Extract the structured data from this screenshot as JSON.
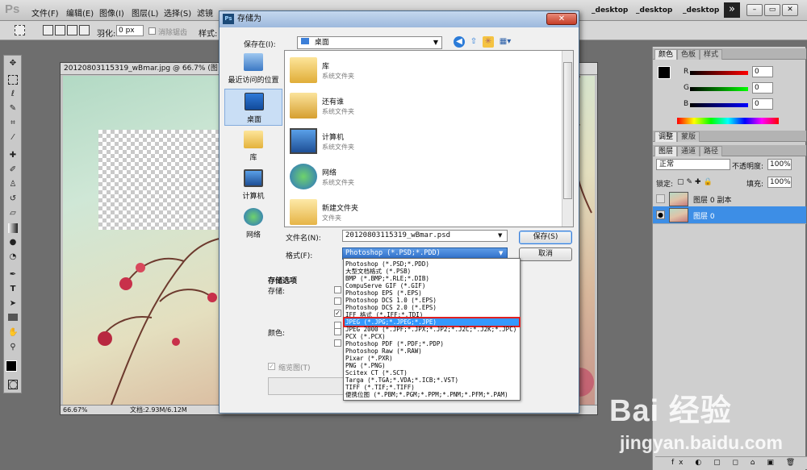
{
  "app": {
    "logo": "Ps"
  },
  "menu": [
    "文件(F)",
    "编辑(E)",
    "图像(I)",
    "图层(L)",
    "选择(S)",
    "滤镜"
  ],
  "workspaces": [
    "_desktop",
    "_desktop",
    "_desktop"
  ],
  "options": {
    "feather_label": "羽化:",
    "feather_value": "0 px",
    "antialias_label": "消除锯齿",
    "style_label": "样式:"
  },
  "document": {
    "title": "20120803115319_wBmar.jpg @ 66.7% (图",
    "zoom": "66.67%",
    "doc_info": "文档:2.93M/6.12M"
  },
  "color_panel": {
    "tabs": [
      "颜色",
      "色板",
      "样式"
    ],
    "r_label": "R",
    "g_label": "G",
    "b_label": "B",
    "r": "0",
    "g": "0",
    "b": "0"
  },
  "adjust_tabs": [
    "调整",
    "蒙版"
  ],
  "layers_panel": {
    "tabs": [
      "图层",
      "通道",
      "路径"
    ],
    "blend_mode": "正常",
    "opacity_label": "不透明度:",
    "opacity": "100%",
    "lock_label": "锁定:",
    "fill_label": "填充:",
    "fill": "100%",
    "layers": [
      {
        "name": "图层 0 副本"
      },
      {
        "name": "图层 0"
      }
    ]
  },
  "dialog": {
    "icon": "Ps",
    "title": "存储为",
    "close": "✕",
    "save_in_label": "保存在(I):",
    "save_in_value": "桌面",
    "places": [
      "最近访问的位置",
      "桌面",
      "库",
      "计算机",
      "网络"
    ],
    "files": [
      {
        "name": "库",
        "type": "系统文件夹"
      },
      {
        "name": "还有谁",
        "type": "系统文件夹"
      },
      {
        "name": "计算机",
        "type": "系统文件夹"
      },
      {
        "name": "网络",
        "type": "系统文件夹"
      },
      {
        "name": "新建文件夹",
        "type": "文件夹"
      }
    ],
    "filename_label": "文件名(N):",
    "filename_value": "20120803115319_wBmar.psd",
    "format_label": "格式(F):",
    "format_value": "Photoshop (*.PSD;*.PDD)",
    "save_button": "保存(S)",
    "cancel_button": "取消",
    "options_title": "存储选项",
    "store_label": "存储:",
    "color_label": "颜色:",
    "thumbnail_label": "缩览图(T)",
    "format_options": [
      "Photoshop (*.PSD;*.PDD)",
      "大型文档格式 (*.PSB)",
      "BMP (*.BMP;*.RLE;*.DIB)",
      "CompuServe GIF (*.GIF)",
      "Photoshop EPS (*.EPS)",
      "Photoshop DCS 1.0 (*.EPS)",
      "Photoshop DCS 2.0 (*.EPS)",
      "IFF 格式 (*.IFF;*.TDI)",
      "JPEG (*.JPG;*.JPEG;*.JPE)",
      "JPEG 2000 (*.JPF;*.JPX;*.JP2;*.J2C;*.J2K;*.JPC)",
      "PCX (*.PCX)",
      "Photoshop PDF (*.PDF;*.PDP)",
      "Photoshop Raw (*.RAW)",
      "Pixar (*.PXR)",
      "PNG (*.PNG)",
      "Scitex CT (*.SCT)",
      "Targa (*.TGA;*.VDA;*.ICB;*.VST)",
      "TIFF (*.TIF;*.TIFF)",
      "便携位图 (*.PBM;*.PGM;*.PPM;*.PNM;*.PFM;*.PAM)"
    ]
  },
  "watermark": {
    "brand": "Bai 经验",
    "url": "jingyan.baidu.com"
  }
}
